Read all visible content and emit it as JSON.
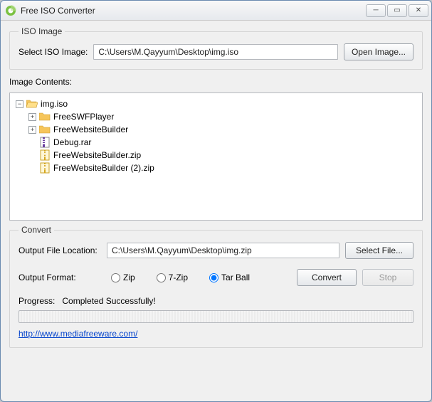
{
  "window": {
    "title": "Free ISO Converter",
    "controls": {
      "min": "—",
      "max": "▢",
      "close": "✕"
    }
  },
  "isoImage": {
    "legend": "ISO Image",
    "selectLabel": "Select ISO Image:",
    "path": "C:\\Users\\M.Qayyum\\Desktop\\img.iso",
    "openButton": "Open Image..."
  },
  "contents": {
    "label": "Image Contents:",
    "tree": {
      "root": {
        "name": "img.iso",
        "expanded": true,
        "icon": "folder-open"
      },
      "children": [
        {
          "name": "FreeSWFPlayer",
          "expanded": false,
          "icon": "folder",
          "hasChildren": true
        },
        {
          "name": "FreeWebsiteBuilder",
          "expanded": false,
          "icon": "folder",
          "hasChildren": true
        },
        {
          "name": "Debug.rar",
          "icon": "rar",
          "hasChildren": false
        },
        {
          "name": "FreeWebsiteBuilder.zip",
          "icon": "zip",
          "hasChildren": false
        },
        {
          "name": "FreeWebsiteBuilder (2).zip",
          "icon": "zip",
          "hasChildren": false
        }
      ]
    }
  },
  "convert": {
    "legend": "Convert",
    "outputLocLabel": "Output File Location:",
    "outputPath": "C:\\Users\\M.Qayyum\\Desktop\\img.zip",
    "selectFileButton": "Select File...",
    "outputFormatLabel": "Output Format:",
    "formats": {
      "zip": "Zip",
      "sevenzip": "7-Zip",
      "tarball": "Tar Ball"
    },
    "selectedFormat": "tarball",
    "convertButton": "Convert",
    "stopButton": "Stop",
    "progressLabel": "Progress:",
    "progressStatus": "Completed Successfully!",
    "link": "http://www.mediafreeware.com/"
  }
}
